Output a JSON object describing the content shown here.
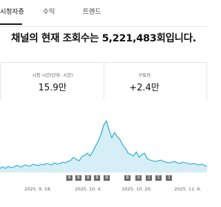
{
  "tabs": [
    {
      "label": "시청자층"
    },
    {
      "label": "수익"
    },
    {
      "label": "트렌드"
    }
  ],
  "headline": "채널의 현재 조회수는 5,221,483회입니다.",
  "stats": [
    {
      "label": "시청 시간(단위: 시간)",
      "value": "15.9만"
    },
    {
      "label": "구독자",
      "value": "+2.4만"
    }
  ],
  "markers": [
    "8",
    "8",
    "8",
    "8",
    "8",
    "8",
    "9",
    "2",
    "5",
    "3"
  ],
  "chart_data": {
    "type": "area",
    "x_tick_labels": [
      "2025. 9. 18.",
      "2025. 10. 4.",
      "2025. 10. 20.",
      "2025. 11. 6."
    ],
    "y": [
      6,
      8,
      6,
      9,
      7,
      8,
      10,
      9,
      8,
      11,
      10,
      9,
      12,
      11,
      10,
      12,
      11,
      13,
      12,
      11,
      14,
      12,
      13,
      15,
      14,
      16,
      18,
      22,
      19,
      17,
      23,
      25,
      28,
      24,
      30,
      38,
      45,
      55,
      68,
      75,
      62,
      50,
      58,
      52,
      48,
      40,
      35,
      28,
      26,
      24,
      30,
      22,
      26,
      28,
      20,
      18,
      17,
      16,
      17,
      18,
      16,
      15,
      14,
      15,
      16,
      14,
      13,
      15,
      14,
      13,
      12,
      13,
      12,
      11,
      12,
      10,
      9
    ],
    "ylim": [
      0,
      90
    ],
    "line_color": "#41b4d2",
    "fill_color": "#d6eef6"
  }
}
